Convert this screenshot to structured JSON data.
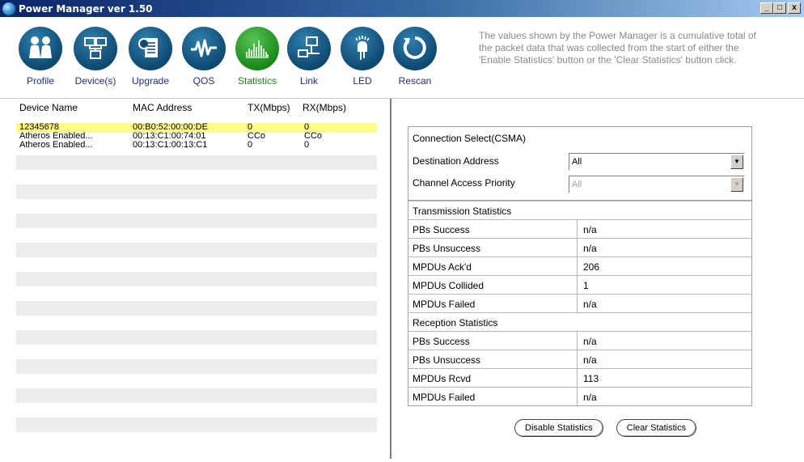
{
  "window": {
    "title": "Power Manager ver 1.50",
    "controls": [
      "_",
      "□",
      "x"
    ]
  },
  "toolbar": {
    "items": [
      {
        "label": "Profile",
        "icon": "people-icon"
      },
      {
        "label": "Device(s)",
        "icon": "network-devices-icon"
      },
      {
        "label": "Upgrade",
        "icon": "upgrade-icon"
      },
      {
        "label": "QOS",
        "icon": "waveform-icon"
      },
      {
        "label": "Statistics",
        "icon": "statistics-icon",
        "active": true
      },
      {
        "label": "Link",
        "icon": "link-icon"
      },
      {
        "label": "LED",
        "icon": "led-icon"
      },
      {
        "label": "Rescan",
        "icon": "rescan-icon"
      }
    ],
    "info": "The values shown by the Power Manager is a cumulative total of the packet data that was collected from the start of either the 'Enable Statistics' button or the 'Clear Statistics' button click."
  },
  "devices": {
    "columns": [
      "Device Name",
      "MAC Address",
      "TX(Mbps)",
      "RX(Mbps)"
    ],
    "rows": [
      {
        "name": "12345678",
        "mac": "00:B0:52:00:00:DE",
        "tx": "0",
        "rx": "0",
        "selected": true
      },
      {
        "name": "Atheros Enabled...",
        "mac": "00:13:C1:00:74:01",
        "tx": "CCo",
        "rx": "CCo"
      },
      {
        "name": "Atheros Enabled...",
        "mac": "00:13:C1:00:13:C1",
        "tx": "0",
        "rx": "0"
      }
    ]
  },
  "connection": {
    "header": "Connection Select(CSMA)",
    "dest_label": "Destination Address",
    "dest_value": "All",
    "priority_label": "Channel Access Priority",
    "priority_value": "All"
  },
  "stats": {
    "tx_header": "Transmission Statistics",
    "tx_rows": [
      {
        "k": "PBs Success",
        "v": "n/a"
      },
      {
        "k": "PBs Unsuccess",
        "v": "n/a"
      },
      {
        "k": "MPDUs Ack'd",
        "v": "206"
      },
      {
        "k": "MPDUs Collided",
        "v": "1"
      },
      {
        "k": "MPDUs Failed",
        "v": "n/a"
      }
    ],
    "rx_header": "Reception Statistics",
    "rx_rows": [
      {
        "k": "PBs Success",
        "v": "n/a"
      },
      {
        "k": "PBs Unsuccess",
        "v": "n/a"
      },
      {
        "k": "MPDUs Rcvd",
        "v": "113"
      },
      {
        "k": "MPDUs Failed",
        "v": "n/a"
      }
    ]
  },
  "buttons": {
    "disable": "Disable Statistics",
    "clear": "Clear Statistics"
  },
  "colors": {
    "titlebar": "#0a246a",
    "icon": "#0e4a72",
    "active_icon": "#1a8a1a",
    "selected_row": "#fdfd88"
  }
}
